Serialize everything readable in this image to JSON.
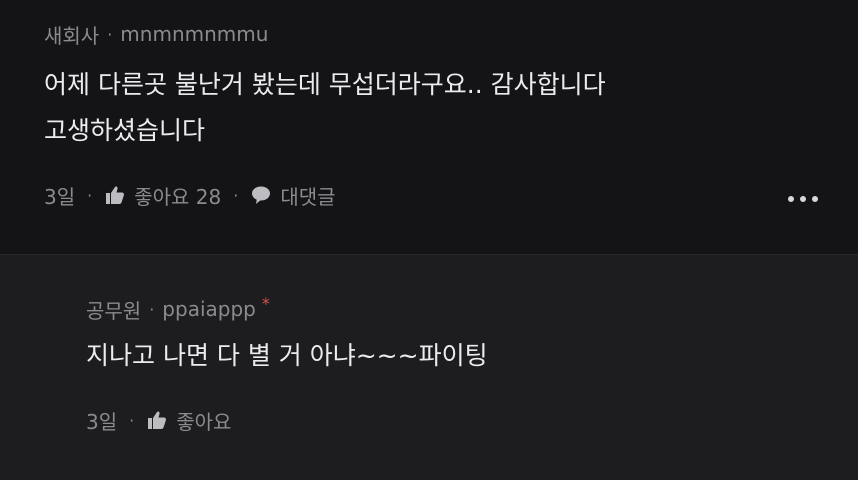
{
  "comment1": {
    "author": "새회사",
    "username": "mnmnmnmmu",
    "lines": [
      "어제 다른곳 불난거 봤는데 무섭더라구요.. 감사합니다",
      "고생하셨습니다"
    ],
    "time": "3일",
    "like_label": "좋아요 28",
    "reply_label": "대댓글"
  },
  "comment2": {
    "author": "공무원",
    "username": "ppaiappp",
    "badge": "*",
    "lines": [
      "지나고 나면 다 별 거 아냐~~~파이팅"
    ],
    "time": "3일",
    "like_label": "좋아요"
  }
}
